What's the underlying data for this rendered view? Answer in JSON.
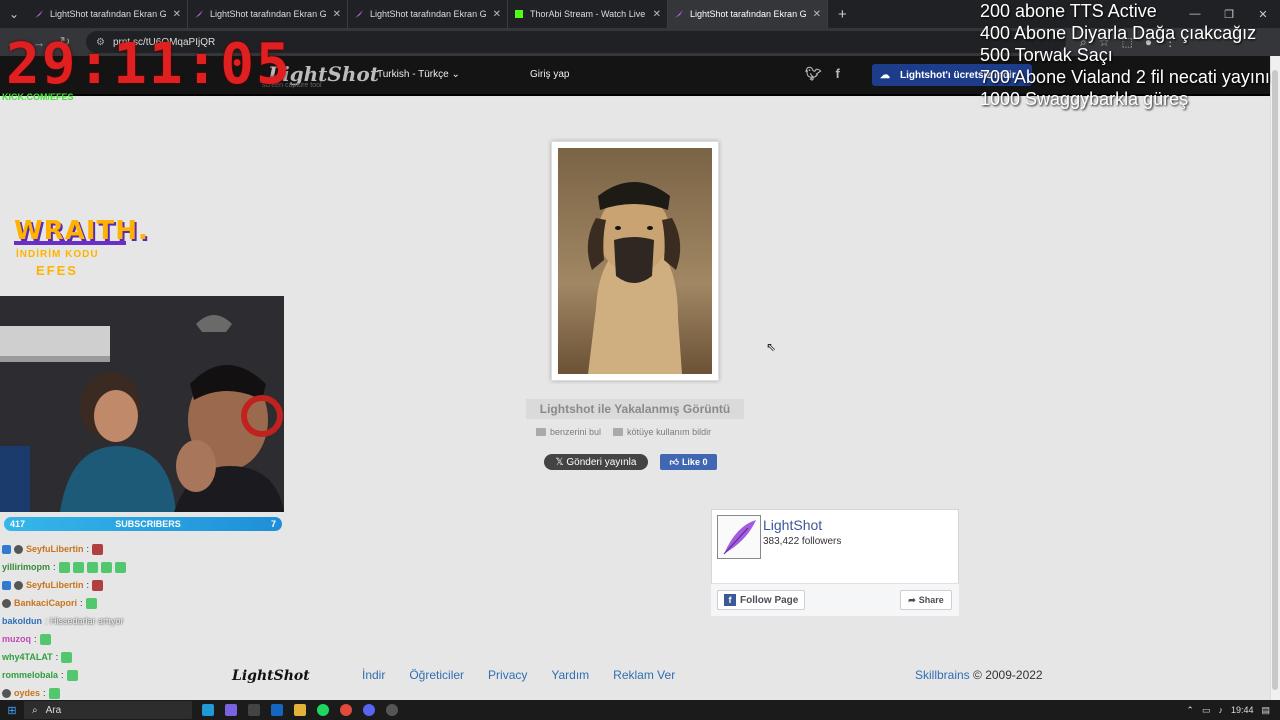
{
  "browser": {
    "tabs": [
      {
        "title": "LightShot tarafından Ekran Görü",
        "active": false,
        "icon": "lightshot-feather-icon"
      },
      {
        "title": "LightShot tarafından Ekran Görü",
        "active": false,
        "icon": "lightshot-feather-icon"
      },
      {
        "title": "LightShot tarafından Ekran Görü",
        "active": false,
        "icon": "lightshot-feather-icon"
      },
      {
        "title": "ThorAbi Stream - Watch Live or",
        "active": false,
        "icon": "kick-icon"
      },
      {
        "title": "LightShot tarafından Ekran Görü",
        "active": true,
        "icon": "lightshot-feather-icon"
      }
    ],
    "new_tab": "+",
    "url": "prnt.sc/tU6OMqaPIjQR"
  },
  "lightshot": {
    "logo": "LightShot",
    "logo_sub": "screen capture tool",
    "language": "Turkish - Türkçe",
    "login": "Giriş yap",
    "get_button": "Lightshot'ı ücretsiz indir",
    "caption": "Lightshot ile Yakalanmış Görüntü",
    "similar": "benzerini bul",
    "report": "kötüye kullanım bildir",
    "post": "Gönderi yayınla",
    "like": "Like 0",
    "fb": {
      "name": "LightShot",
      "followers": "383,422 followers",
      "follow": "Follow Page",
      "share": "Share"
    },
    "footer": {
      "logo": "LightShot",
      "links": [
        "İndir",
        "Öğreticiler",
        "Privacy",
        "Yardım",
        "Reklam Ver"
      ],
      "company": "Skillbrains",
      "copyright": "© 2009-2022"
    }
  },
  "overlay": {
    "timer": "29:11:05",
    "kick": "KICK.COM/EFES",
    "goals": [
      "200 abone TTS Active",
      "400 Abone Diyarla Dağa çıakcağız",
      "500 Torwak Saçı",
      "700 Abone Vialand 2 fil necati yayını",
      "1000 Swaggybarkla güreş"
    ],
    "wraith_title": "WRAITH.",
    "wraith_sub": "İNDİRİM KODU",
    "wraith_code": "EFES",
    "subs_count": "417",
    "subs_label": "SUBSCRIBERS",
    "subs_right": "7",
    "chat": [
      {
        "user": "SeyfuLibertin",
        "msg": ":",
        "color": "#c8741c"
      },
      {
        "user": "yillirimopm",
        "msg": ":",
        "color": "#3a8a3a"
      },
      {
        "user": "SeyfuLibertin",
        "msg": ":",
        "color": "#c8741c"
      },
      {
        "user": "BankaciCapori",
        "msg": ":",
        "color": "#c8741c"
      },
      {
        "user": "bakoldun",
        "msg": ": Hissedarlar artıyor",
        "color": "#2f6fb3"
      },
      {
        "user": "muzoq",
        "msg": ":",
        "color": "#c04bb4"
      },
      {
        "user": "why4TALAT",
        "msg": ":",
        "color": "#2f9f3f"
      },
      {
        "user": "rommelobala",
        "msg": ":",
        "color": "#2f9f3f"
      },
      {
        "user": "oydes",
        "msg": ":",
        "color": "#c8741c"
      }
    ]
  },
  "taskbar": {
    "search": "Ara",
    "time": "19:44"
  },
  "colors": {
    "accent_blue": "#1d3d8a",
    "link_blue": "#2f6fb3",
    "timer_red": "#e02020"
  }
}
